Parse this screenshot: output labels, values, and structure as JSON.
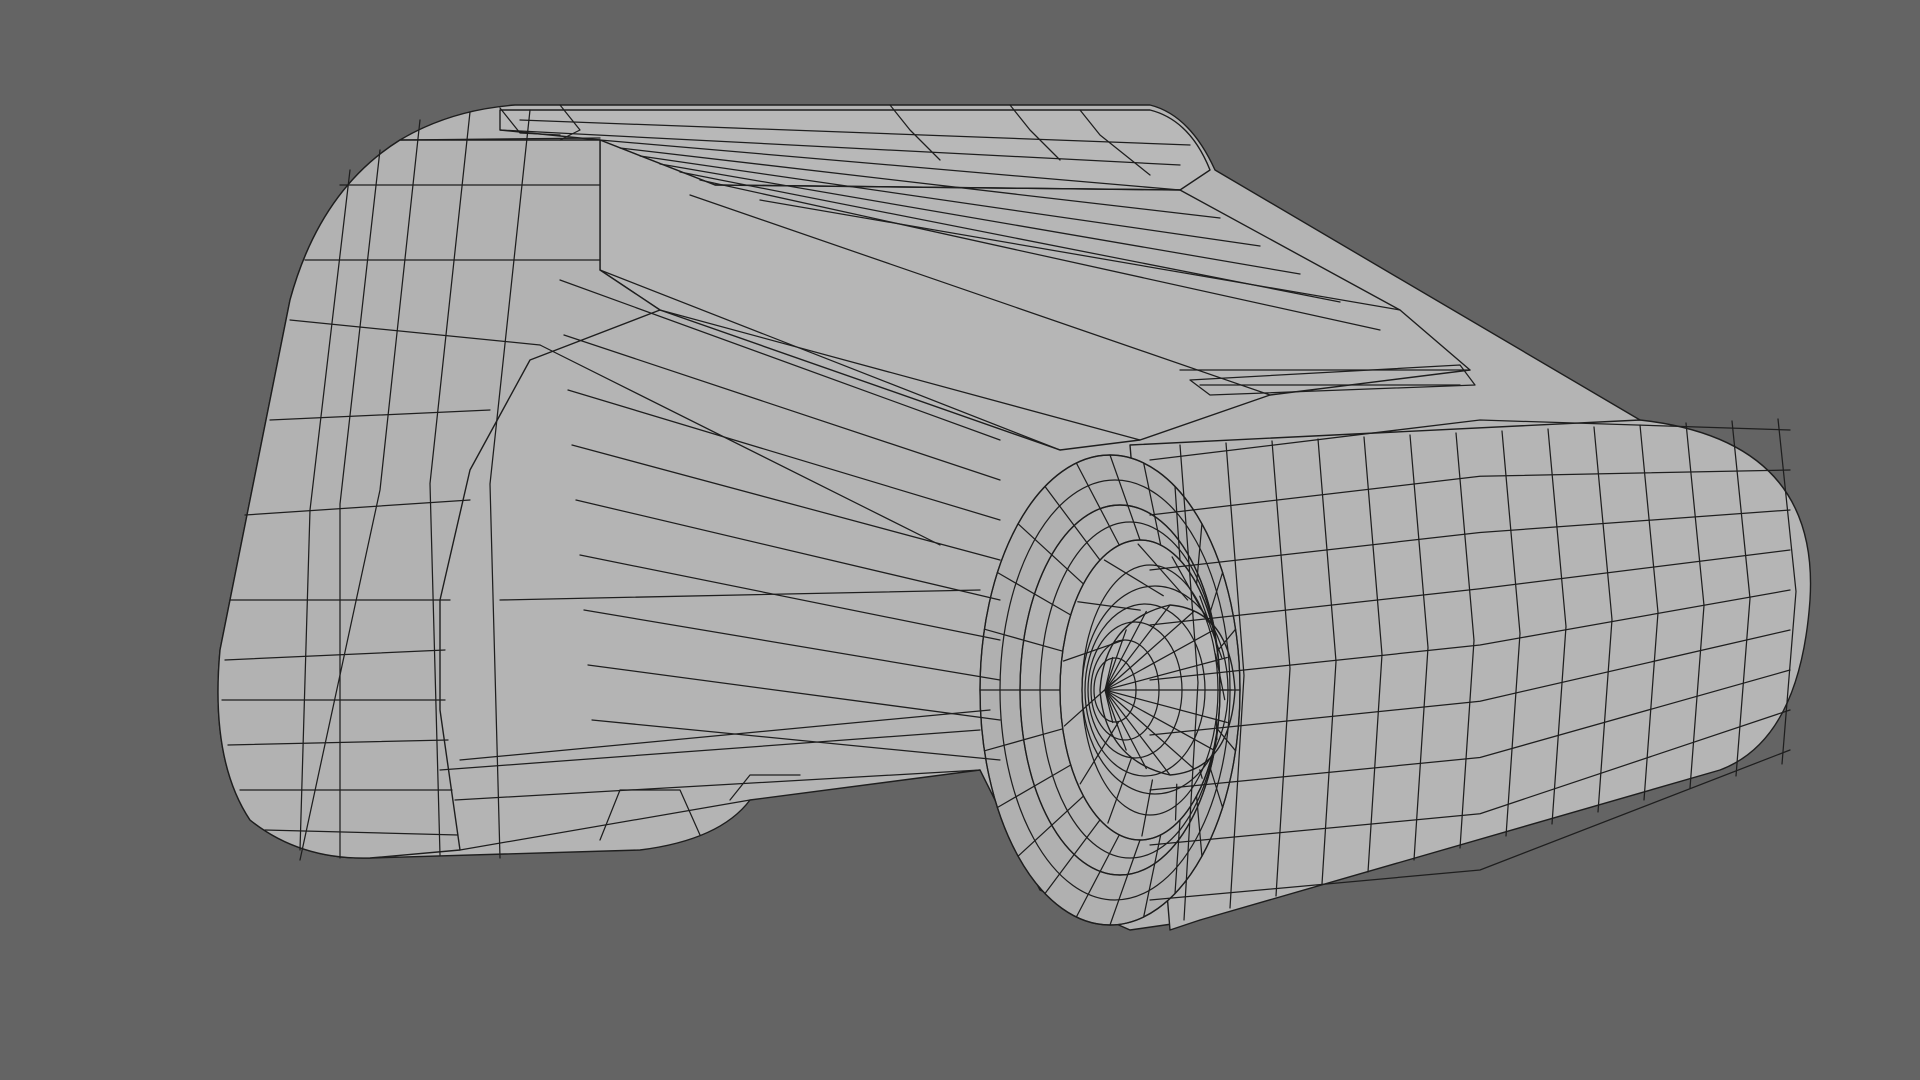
{
  "scene": {
    "background_color": "#646464",
    "mesh_color": "#b3b3b3",
    "wire_color": "#1e1e1e",
    "display_mode": "wireframe-on-shaded",
    "object": "mechanical-pod-with-intake-fan"
  }
}
